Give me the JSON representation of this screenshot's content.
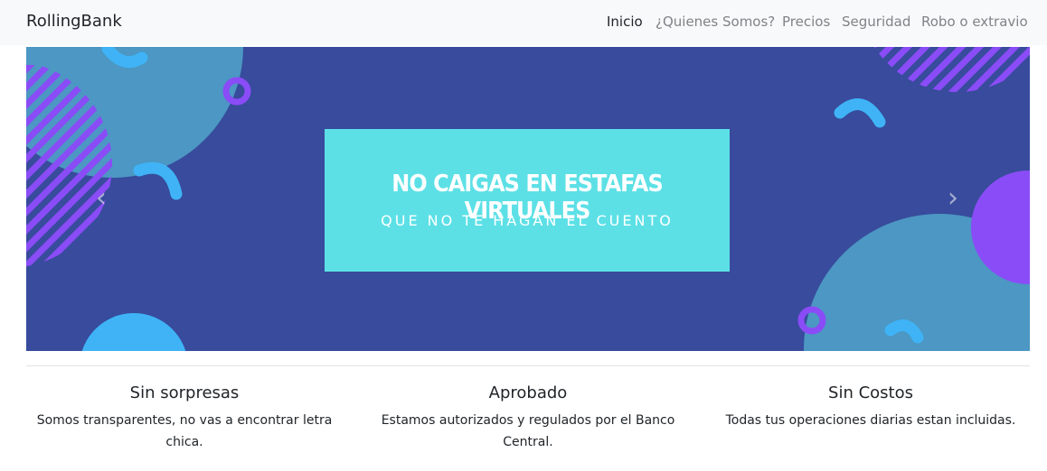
{
  "navbar": {
    "brand": "RollingBank",
    "links": [
      {
        "label": "Inicio",
        "active": true
      },
      {
        "label": "¿Quienes Somos?",
        "active": false
      },
      {
        "label": "Precios",
        "active": false
      },
      {
        "label": "Seguridad",
        "active": false
      },
      {
        "label": "Robo o extravio",
        "active": false
      }
    ]
  },
  "carousel": {
    "title": "NO CAIGAS EN ESTAFAS VIRTUALES",
    "subtitle": "QUE NO TE HAGAN EL CUENTO",
    "prev_icon": "chevron-left-icon",
    "next_icon": "chevron-right-icon",
    "colors": {
      "background": "#384b9c",
      "box": "#5ce0e6",
      "circle": "#4c97c3",
      "accent_blue": "#3fb3f6",
      "accent_purple": "#8a4cf6"
    }
  },
  "features": [
    {
      "title": "Sin sorpresas",
      "text": "Somos transparentes, no vas a encontrar letra chica."
    },
    {
      "title": "Aprobado",
      "text": "Estamos autorizados y regulados por el Banco Central."
    },
    {
      "title": "Sin Costos",
      "text": "Todas tus operaciones diarias estan incluidas."
    }
  ]
}
